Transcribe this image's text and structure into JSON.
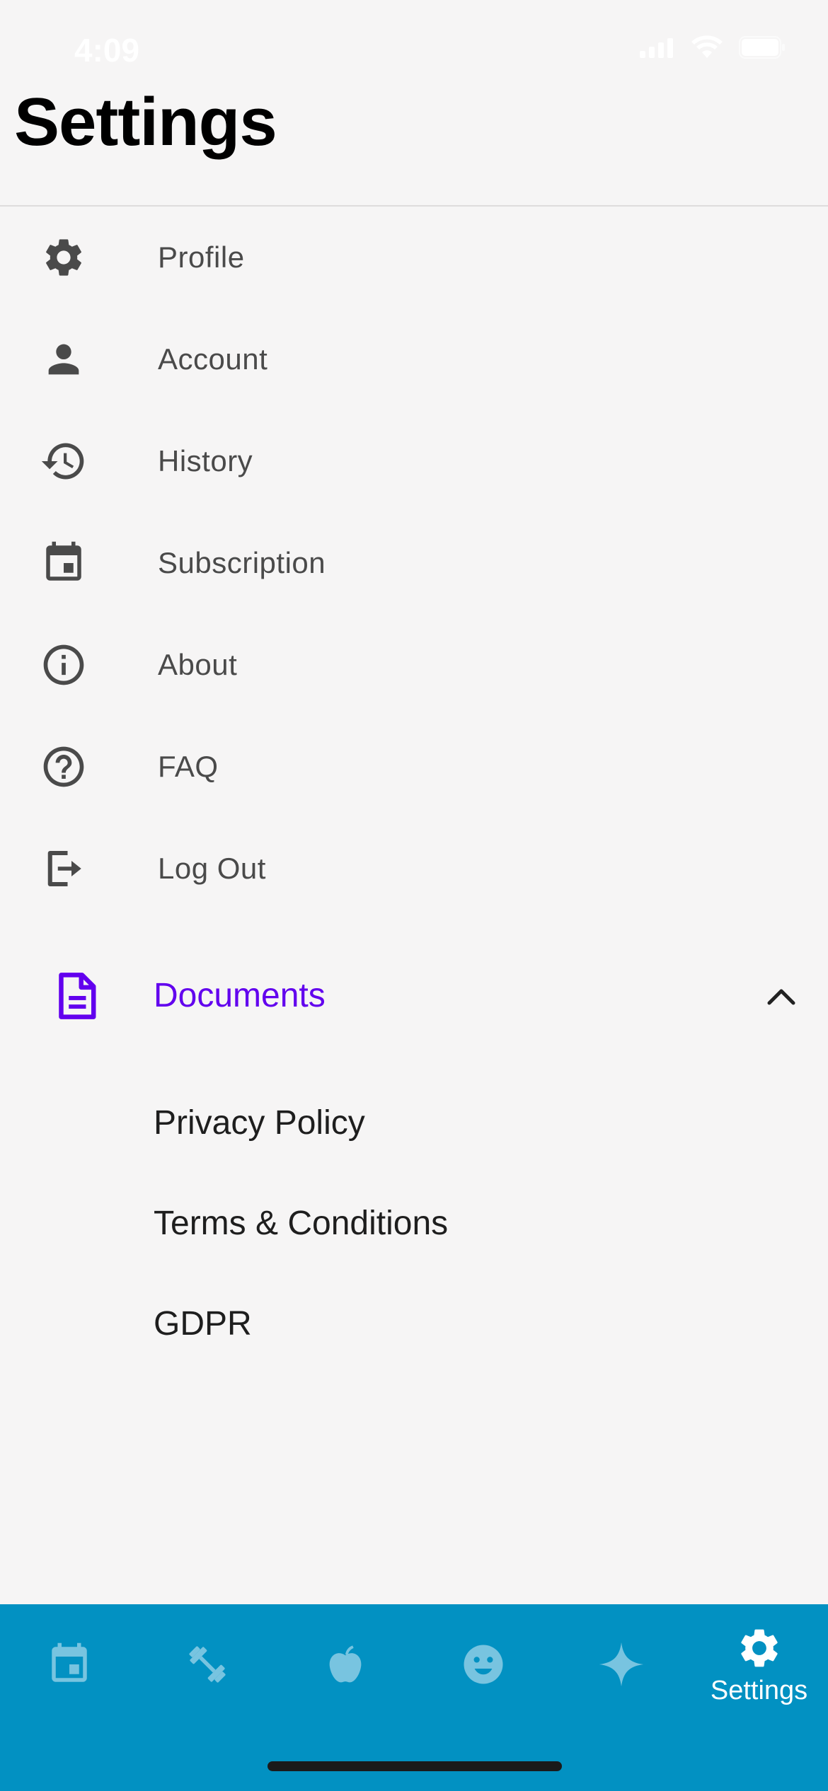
{
  "status_bar": {
    "time": "4:09"
  },
  "header": {
    "title": "Settings"
  },
  "menu": [
    {
      "label": "Profile",
      "icon": "gear-icon"
    },
    {
      "label": "Account",
      "icon": "person-icon"
    },
    {
      "label": "History",
      "icon": "history-icon"
    },
    {
      "label": "Subscription",
      "icon": "calendar-icon"
    },
    {
      "label": "About",
      "icon": "info-icon"
    },
    {
      "label": "FAQ",
      "icon": "help-icon"
    },
    {
      "label": "Log Out",
      "icon": "logout-icon"
    }
  ],
  "documents": {
    "label": "Documents",
    "icon": "document-icon",
    "expanded": true,
    "items": [
      "Privacy Policy",
      "Terms & Conditions",
      "GDPR"
    ]
  },
  "tab_bar": {
    "tabs": [
      {
        "icon": "calendar-icon",
        "label": ""
      },
      {
        "icon": "dumbbell-icon",
        "label": ""
      },
      {
        "icon": "apple-icon",
        "label": ""
      },
      {
        "icon": "smiley-icon",
        "label": ""
      },
      {
        "icon": "sparkle-icon",
        "label": ""
      },
      {
        "icon": "gear-icon",
        "label": "Settings",
        "active": true
      }
    ]
  },
  "colors": {
    "accent": "#6200ee",
    "tab_bar": "#0291c2",
    "tab_icon_inactive": "#78c4e0",
    "icon": "#4a4a4a",
    "background": "#f6f5f5"
  }
}
